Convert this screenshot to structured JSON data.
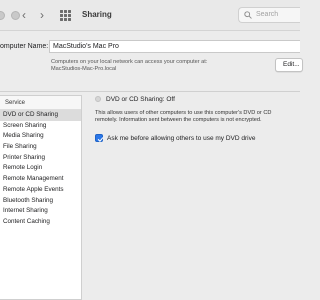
{
  "window": {
    "title": "Sharing"
  },
  "toolbar": {
    "back_label": "‹",
    "forward_label": "›",
    "search_placeholder": "Search"
  },
  "computer_name": {
    "label": "omputer Name:",
    "value": "MacStudio's Mac Pro",
    "desc_line1": "Computers on your local network can access your computer at:",
    "desc_line2": "MacStudios-Mac-Pro.local",
    "edit_label": "Edit..."
  },
  "services": {
    "header": "Service",
    "items": [
      {
        "label": "DVD or CD Sharing",
        "selected": true
      },
      {
        "label": "Screen Sharing",
        "selected": false
      },
      {
        "label": "Media Sharing",
        "selected": false
      },
      {
        "label": "File Sharing",
        "selected": false
      },
      {
        "label": "Printer Sharing",
        "selected": false
      },
      {
        "label": "Remote Login",
        "selected": false
      },
      {
        "label": "Remote Management",
        "selected": false
      },
      {
        "label": "Remote Apple Events",
        "selected": false
      },
      {
        "label": "Bluetooth Sharing",
        "selected": false
      },
      {
        "label": "Internet Sharing",
        "selected": false
      },
      {
        "label": "Content Caching",
        "selected": false
      }
    ]
  },
  "detail": {
    "status": "DVD or CD Sharing: Off",
    "desc_line1": "This allows users of other computers to use this computer's DVD or CD",
    "desc_line2": "remotely. Information sent between the computers is not encrypted.",
    "checkbox_label": "Ask me before allowing others to use my DVD drive",
    "checkbox_checked": true
  },
  "colors": {
    "accent": "#2b77e8",
    "selection": "#dcdcdc"
  }
}
